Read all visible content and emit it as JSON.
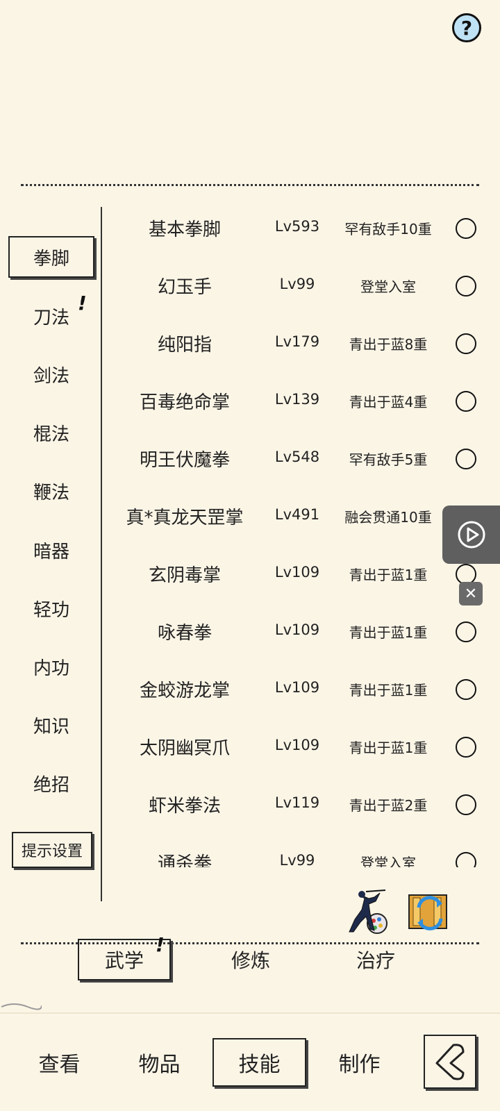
{
  "help": {
    "icon": "question-icon",
    "label": "?"
  },
  "categories": [
    {
      "label": "拳脚",
      "selected": true
    },
    {
      "label": "刀法",
      "alert": "!"
    },
    {
      "label": "剑法"
    },
    {
      "label": "棍法"
    },
    {
      "label": "鞭法"
    },
    {
      "label": "暗器"
    },
    {
      "label": "轻功"
    },
    {
      "label": "内功"
    },
    {
      "label": "知识"
    },
    {
      "label": "绝招"
    }
  ],
  "hint_settings": {
    "label": "提示设置"
  },
  "skills": [
    {
      "name": "基本拳脚",
      "level": "Lv593",
      "tier": "罕有敌手10重"
    },
    {
      "name": "幻玉手",
      "level": "Lv99",
      "tier": "登堂入室"
    },
    {
      "name": "纯阳指",
      "level": "Lv179",
      "tier": "青出于蓝8重"
    },
    {
      "name": "百毒绝命掌",
      "level": "Lv139",
      "tier": "青出于蓝4重"
    },
    {
      "name": "明王伏魔拳",
      "level": "Lv548",
      "tier": "罕有敌手5重"
    },
    {
      "name": "真*真龙天罡掌",
      "level": "Lv491",
      "tier": "融会贯通10重"
    },
    {
      "name": "玄阴毒掌",
      "level": "Lv109",
      "tier": "青出于蓝1重"
    },
    {
      "name": "咏春拳",
      "level": "Lv109",
      "tier": "青出于蓝1重"
    },
    {
      "name": "金蛟游龙掌",
      "level": "Lv109",
      "tier": "青出于蓝1重"
    },
    {
      "name": "太阴幽冥爪",
      "level": "Lv109",
      "tier": "青出于蓝1重"
    },
    {
      "name": "虾米拳法",
      "level": "Lv119",
      "tier": "青出于蓝2重"
    },
    {
      "name": "通杀拳",
      "level": "Lv99",
      "tier": "登堂入室"
    }
  ],
  "action_icons": [
    "fighter-palette-icon",
    "scroll-swap-icon"
  ],
  "sub_tabs": [
    {
      "label": "武学",
      "selected": true,
      "alert": "!"
    },
    {
      "label": "修炼"
    },
    {
      "label": "治疗"
    }
  ],
  "nav_tabs": [
    {
      "label": "查看"
    },
    {
      "label": "物品"
    },
    {
      "label": "技能",
      "selected": true
    },
    {
      "label": "制作"
    }
  ],
  "back": {
    "icon": "back-arrow-icon"
  },
  "overlay": {
    "play_icon": "play-icon",
    "close_label": "✕"
  },
  "colors": {
    "background": "#fbf5e6",
    "ink": "#222222",
    "help_fill": "#bfe3f5",
    "overlay": "#5f5f5f"
  }
}
